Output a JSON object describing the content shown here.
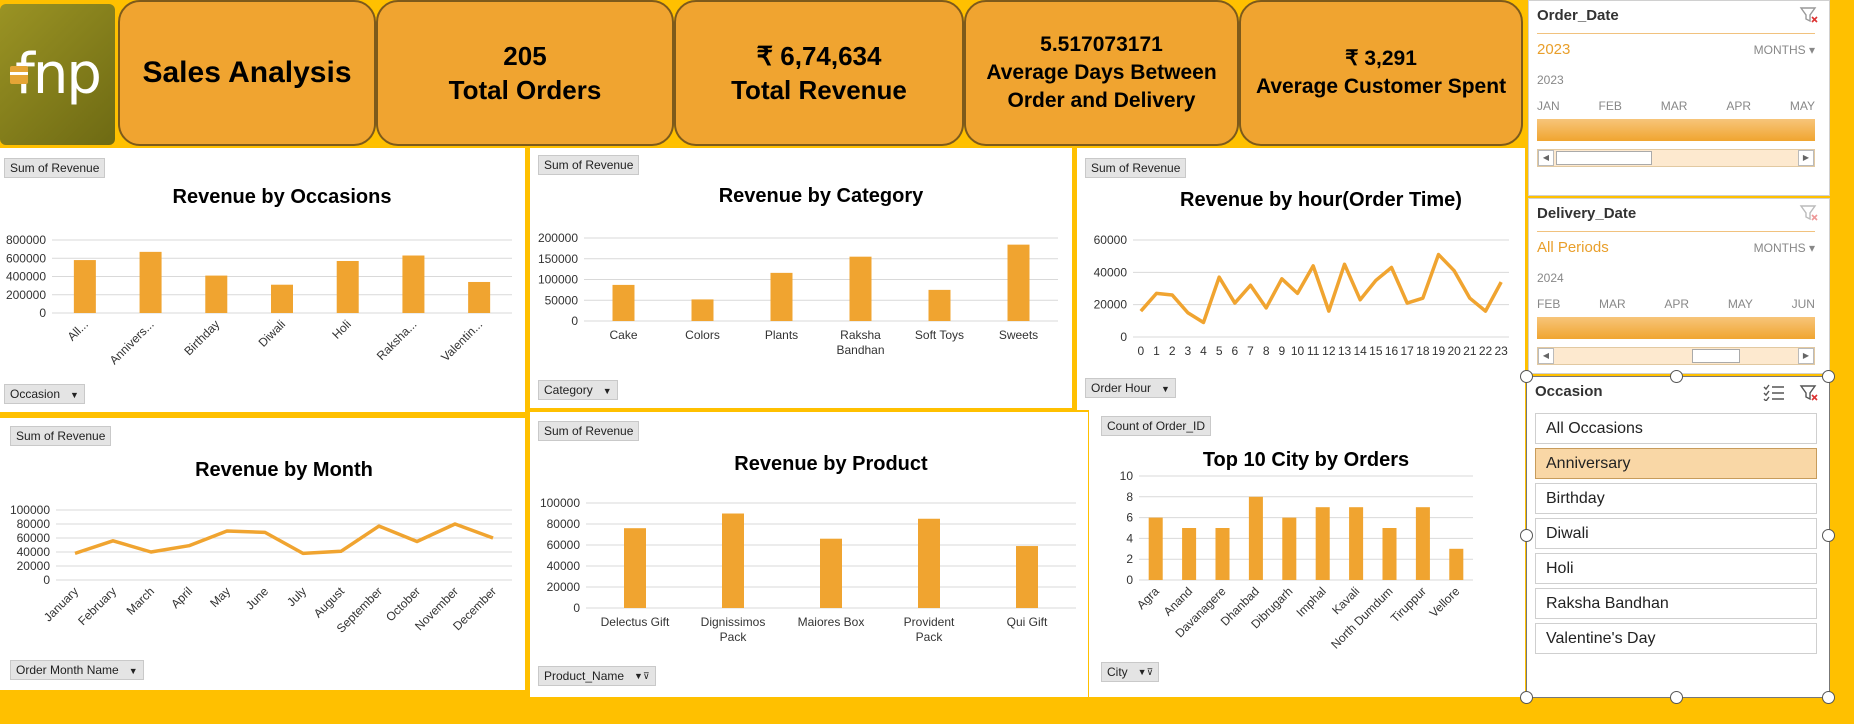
{
  "logo": {
    "text": "fnp"
  },
  "header": {
    "title": "Sales Analysis",
    "kpis": [
      {
        "value": "205",
        "label": "Total Orders"
      },
      {
        "value": "₹ 6,74,634",
        "label": "Total Revenue"
      },
      {
        "value": "5.517073171",
        "label": "Average Days Between Order and Delivery"
      },
      {
        "value": "₹ 3,291",
        "label": "Average Customer Spent"
      }
    ]
  },
  "colors": {
    "accent": "#F0A430",
    "background": "#FFC000",
    "gridline": "#d9d9d9"
  },
  "panels": {
    "occasions": {
      "field_button": "Sum of Revenue",
      "axis_button": "Occasion"
    },
    "category": {
      "field_button": "Sum of Revenue",
      "axis_button": "Category"
    },
    "hour": {
      "field_button": "Sum of Revenue",
      "axis_button": "Order Hour"
    },
    "month": {
      "field_button": "Sum of Revenue",
      "axis_button": "Order Month Name"
    },
    "product": {
      "field_button": "Sum of Revenue",
      "axis_button": "Product_Name"
    },
    "city": {
      "field_button": "Count of Order_ID",
      "axis_button": "City"
    }
  },
  "chart_data": [
    {
      "id": "occasions",
      "type": "bar",
      "title": "Revenue by Occasions",
      "categories": [
        "All...",
        "Annivers...",
        "Birthday",
        "Diwali",
        "Holi",
        "Raksha...",
        "Valentin..."
      ],
      "values": [
        580000,
        670000,
        410000,
        310000,
        570000,
        630000,
        340000
      ],
      "yticks": [
        0,
        200000,
        400000,
        600000,
        800000
      ],
      "ylim": [
        0,
        800000
      ],
      "grid": true,
      "tick_rotate": true
    },
    {
      "id": "category",
      "type": "bar",
      "title": "Revenue by Category",
      "categories": [
        "Cake",
        "Colors",
        "Plants",
        "Raksha Bandhan",
        "Soft Toys",
        "Sweets"
      ],
      "values": [
        87000,
        52000,
        116000,
        155000,
        75000,
        184000
      ],
      "yticks": [
        0,
        50000,
        100000,
        150000,
        200000
      ],
      "ylim": [
        0,
        200000
      ],
      "grid": true,
      "tick_rotate": false
    },
    {
      "id": "hour",
      "type": "line",
      "title": "Revenue by hour(Order Time)",
      "categories": [
        "0",
        "1",
        "2",
        "3",
        "4",
        "5",
        "6",
        "7",
        "8",
        "9",
        "10",
        "11",
        "12",
        "13",
        "14",
        "15",
        "16",
        "17",
        "18",
        "19",
        "20",
        "21",
        "22",
        "23"
      ],
      "values": [
        16000,
        27000,
        26000,
        15000,
        9000,
        37000,
        21000,
        32000,
        18000,
        36000,
        27000,
        44000,
        16000,
        45000,
        23000,
        35000,
        43000,
        21000,
        24000,
        51000,
        41000,
        24000,
        16000,
        34000
      ],
      "yticks": [
        0,
        20000,
        40000,
        60000
      ],
      "ylim": [
        0,
        60000
      ],
      "grid": true,
      "tick_rotate": false
    },
    {
      "id": "month",
      "type": "line",
      "title": "Revenue by Month",
      "categories": [
        "January",
        "February",
        "March",
        "April",
        "May",
        "June",
        "July",
        "August",
        "September",
        "October",
        "November",
        "December"
      ],
      "values": [
        38000,
        56000,
        40000,
        49000,
        70000,
        68000,
        38000,
        41000,
        77000,
        55000,
        80000,
        60000
      ],
      "yticks": [
        0,
        20000,
        40000,
        60000,
        80000,
        100000
      ],
      "ylim": [
        0,
        100000
      ],
      "grid": true,
      "tick_rotate": true
    },
    {
      "id": "product",
      "type": "bar",
      "title": "Revenue by Product",
      "categories": [
        "Delectus Gift",
        "Dignissimos Pack",
        "Maiores Box",
        "Provident Pack",
        "Qui Gift"
      ],
      "values": [
        76000,
        90000,
        66000,
        85000,
        59000
      ],
      "yticks": [
        0,
        20000,
        40000,
        60000,
        80000,
        100000
      ],
      "ylim": [
        0,
        100000
      ],
      "grid": true,
      "tick_rotate": false
    },
    {
      "id": "city",
      "type": "bar",
      "title": "Top 10 City by Orders",
      "categories": [
        "Agra",
        "Anand",
        "Davanagere",
        "Dhanbad",
        "Dibrugarh",
        "Imphal",
        "Kavali",
        "North Dumdum",
        "Tiruppur",
        "Vellore"
      ],
      "values": [
        6,
        5,
        5,
        8,
        6,
        7,
        7,
        5,
        7,
        3
      ],
      "yticks": [
        0,
        2,
        4,
        6,
        8,
        10
      ],
      "ylim": [
        0,
        10
      ],
      "grid": true,
      "tick_rotate": true
    }
  ],
  "slicers": {
    "order_date": {
      "title": "Order_Date",
      "selection": "2023",
      "level": "MONTHS",
      "year": "2023",
      "months": [
        "JAN",
        "FEB",
        "MAR",
        "APR",
        "MAY"
      ]
    },
    "delivery_date": {
      "title": "Delivery_Date",
      "selection": "All Periods",
      "level": "MONTHS",
      "year": "2024",
      "months": [
        "FEB",
        "MAR",
        "APR",
        "MAY",
        "JUN"
      ]
    },
    "occasion": {
      "title": "Occasion",
      "items": [
        "All Occasions",
        "Anniversary",
        "Birthday",
        "Diwali",
        "Holi",
        "Raksha Bandhan",
        "Valentine's Day"
      ],
      "selected": "Anniversary"
    }
  }
}
